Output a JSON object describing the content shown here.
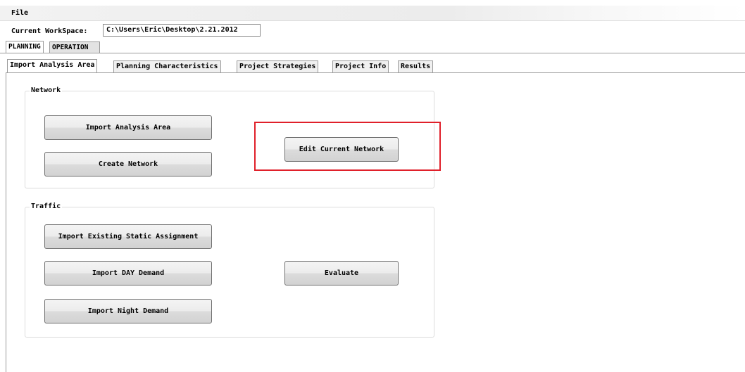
{
  "menu": {
    "file": "File"
  },
  "workspace": {
    "label": "Current WorkSpace:",
    "path": "C:\\Users\\Eric\\Desktop\\2.21.2012"
  },
  "outer_tabs": [
    "PLANNING",
    "OPERATION"
  ],
  "inner_tabs": [
    "Import Analysis Area",
    "Planning Characteristics",
    "Project Strategies",
    "Project Info",
    "Results"
  ],
  "network": {
    "title": "Network",
    "import_area": "Import Analysis Area",
    "create_network": "Create Network",
    "edit_network": "Edit Current Network"
  },
  "traffic": {
    "title": "Traffic",
    "import_static": "Import Existing Static Assignment",
    "import_day": "Import DAY Demand",
    "import_night": "Import Night Demand",
    "evaluate": "Evaluate"
  },
  "colors": {
    "highlight": "#e0202a",
    "selected_tab": "#ffffff",
    "tab": "#e3e3e3"
  }
}
